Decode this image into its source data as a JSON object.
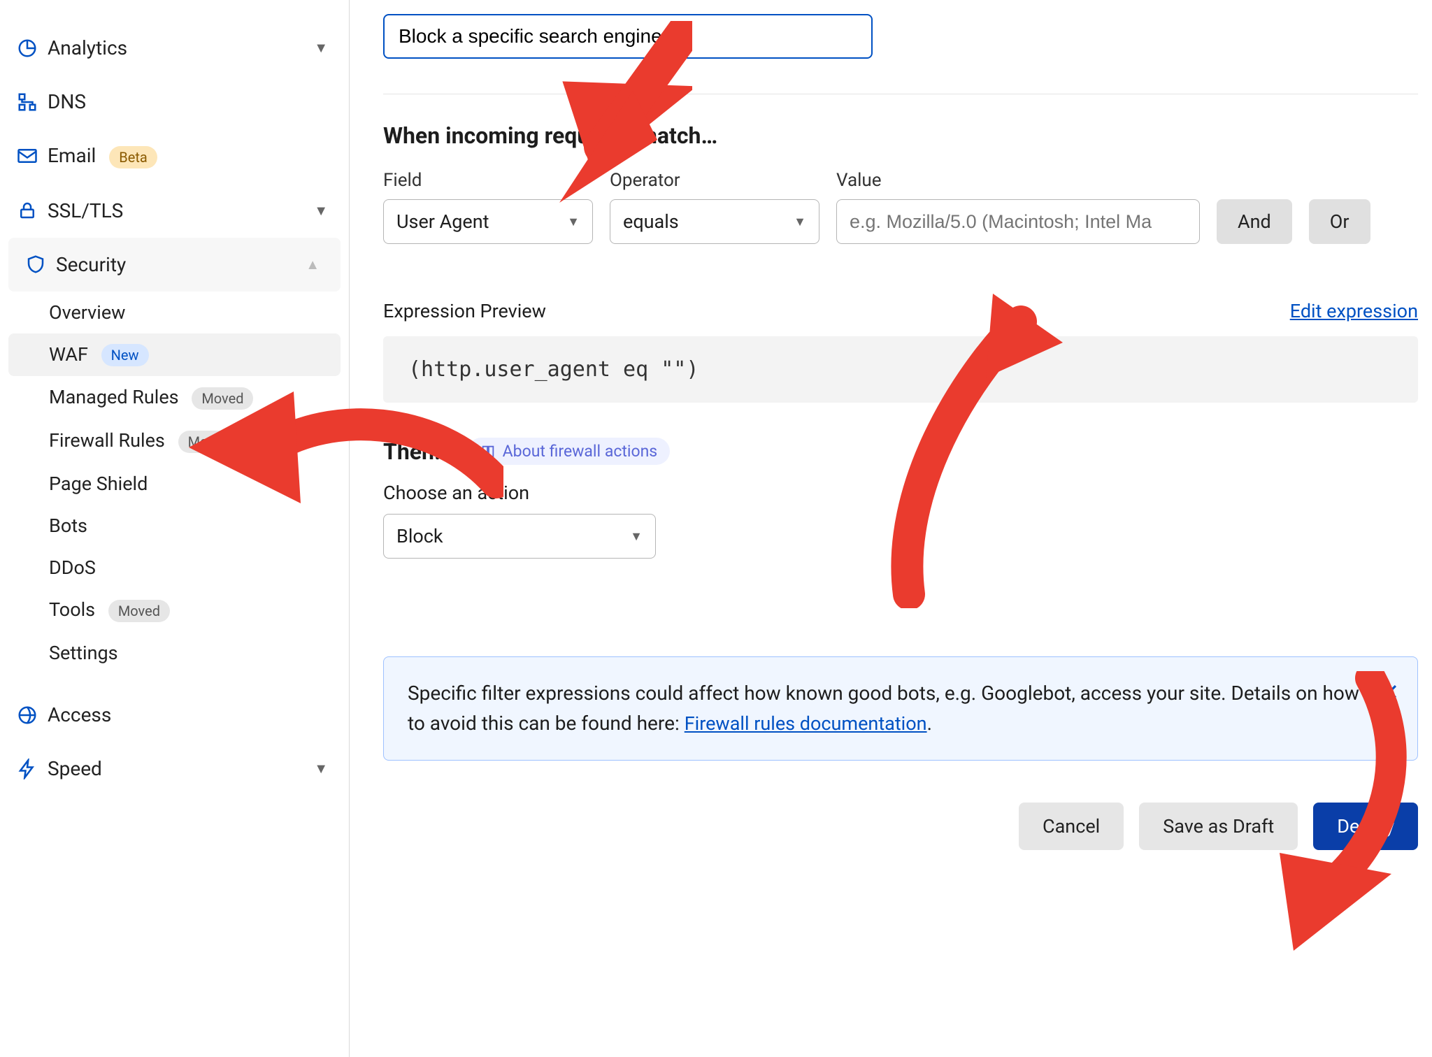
{
  "sidebar": {
    "analytics": "Analytics",
    "dns": "DNS",
    "email": "Email",
    "email_badge": "Beta",
    "ssltls": "SSL/TLS",
    "security": "Security",
    "security_items": {
      "overview": "Overview",
      "waf": "WAF",
      "waf_badge": "New",
      "managed_rules": "Managed Rules",
      "managed_rules_badge": "Moved",
      "firewall_rules": "Firewall Rules",
      "firewall_rules_badge": "Moved",
      "page_shield": "Page Shield",
      "bots": "Bots",
      "ddos": "DDoS",
      "tools": "Tools",
      "tools_badge": "Moved",
      "settings": "Settings"
    },
    "access": "Access",
    "speed": "Speed"
  },
  "main": {
    "rule_name_value": "Block a specific search engine",
    "section_match_title": "When incoming requests match…",
    "labels": {
      "field": "Field",
      "operator": "Operator",
      "value": "Value"
    },
    "field_selected": "User Agent",
    "operator_selected": "equals",
    "value_placeholder": "e.g. Mozilla/5.0 (Macintosh; Intel Ma",
    "btn_and": "And",
    "btn_or": "Or",
    "preview_label": "Expression Preview",
    "edit_expression": "Edit expression",
    "preview_code": "(http.user_agent eq \"\")",
    "then_title": "Then…",
    "about_actions": "About firewall actions",
    "choose_action": "Choose an action",
    "action_selected": "Block",
    "notice_text_1": "Specific filter expressions could affect how known good bots, e.g. Googlebot, access your site. Details on how to avoid this can be found here: ",
    "notice_link": "Firewall rules documentation",
    "cancel": "Cancel",
    "save_draft": "Save as Draft",
    "deploy": "Deploy"
  }
}
